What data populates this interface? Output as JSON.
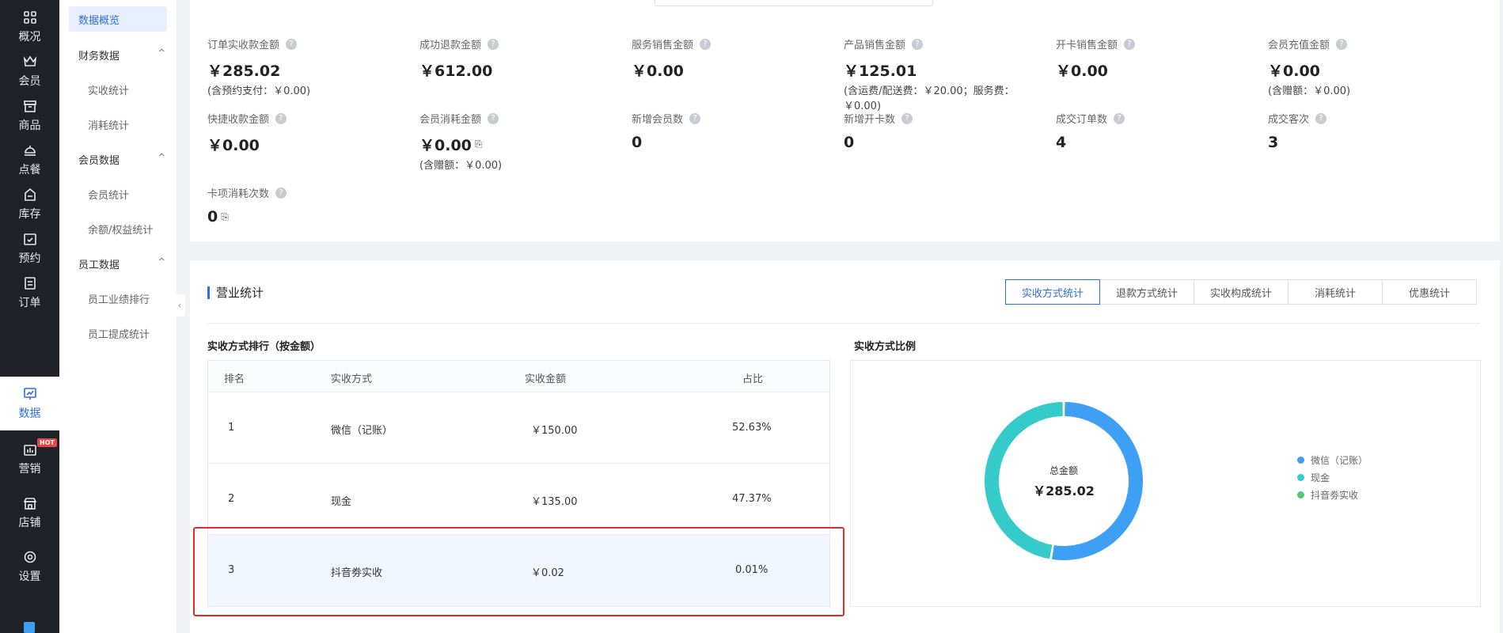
{
  "nav": {
    "items": [
      {
        "label": "概况",
        "icon": "grid-icon"
      },
      {
        "label": "会员",
        "icon": "crown-icon"
      },
      {
        "label": "商品",
        "icon": "store-box-icon"
      },
      {
        "label": "点餐",
        "icon": "dish-icon"
      },
      {
        "label": "库存",
        "icon": "inventory-icon"
      },
      {
        "label": "预约",
        "icon": "calendar-check-icon"
      },
      {
        "label": "订单",
        "icon": "order-list-icon"
      },
      {
        "label": "数据",
        "icon": "data-chart-icon"
      },
      {
        "label": "营销",
        "icon": "marketing-icon"
      },
      {
        "label": "店铺",
        "icon": "shop-icon"
      },
      {
        "label": "设置",
        "icon": "settings-icon"
      }
    ],
    "active": "数据",
    "hot_badge": "HOT"
  },
  "submenu": {
    "active": "数据概览",
    "groups": [
      {
        "label": "财务数据",
        "items": [
          "实收统计",
          "消耗统计"
        ]
      },
      {
        "label": "会员数据",
        "items": [
          "会员统计",
          "余额/权益统计"
        ]
      },
      {
        "label": "员工数据",
        "items": [
          "员工业绩排行",
          "员工提成统计"
        ]
      }
    ],
    "caret": "^",
    "collapse": "‹"
  },
  "stats": [
    {
      "label": "订单实收款金额",
      "value": "￥285.02",
      "note": "(含预约支付：￥0.00)"
    },
    {
      "label": "成功退款金额",
      "value": "￥612.00",
      "note": ""
    },
    {
      "label": "服务销售金额",
      "value": "￥0.00",
      "note": ""
    },
    {
      "label": "产品销售金额",
      "value": "￥125.01",
      "note": "(含运费/配送费：￥20.00；服务费：￥0.00)"
    },
    {
      "label": "开卡销售金额",
      "value": "￥0.00",
      "note": ""
    },
    {
      "label": "会员充值金额",
      "value": "￥0.00",
      "note": "(含赠额：￥0.00)"
    },
    {
      "label": "快捷收款金额",
      "value": "￥0.00",
      "note": ""
    },
    {
      "label": "会员消耗金额",
      "value": "￥0.00",
      "note": "(含赠额：￥0.00)",
      "doc": "⎘"
    },
    {
      "label": "新增会员数",
      "value": "0",
      "note": ""
    },
    {
      "label": "新增开卡数",
      "value": "0",
      "note": ""
    },
    {
      "label": "成交订单数",
      "value": "4",
      "note": ""
    },
    {
      "label": "成交客次",
      "value": "3",
      "note": ""
    },
    {
      "label": "卡项消耗次数",
      "value": "0",
      "note": "",
      "doc": "⎘"
    }
  ],
  "help_glyph": "?",
  "business": {
    "title": "营业统计",
    "tabs": [
      "实收方式统计",
      "退款方式统计",
      "实收构成统计",
      "消耗统计",
      "优惠统计"
    ],
    "active_tab": "实收方式统计",
    "ranking_title": "实收方式排行（按金额）",
    "ratio_title": "实收方式比例",
    "table": {
      "headers": [
        "排名",
        "实收方式",
        "实收金额",
        "占比"
      ],
      "rows": [
        {
          "rank": "1",
          "method": "微信（记账）",
          "amount": "￥150.00",
          "ratio": "52.63%"
        },
        {
          "rank": "2",
          "method": "现金",
          "amount": "￥135.00",
          "ratio": "47.37%"
        },
        {
          "rank": "3",
          "method": "抖音劵实收",
          "amount": "￥0.02",
          "ratio": "0.01%"
        }
      ]
    },
    "donut": {
      "center_label": "总金额",
      "center_value": "￥285.02"
    }
  },
  "chart_data": {
    "type": "pie",
    "categories": [
      "微信（记账）",
      "现金",
      "抖音劵实收"
    ],
    "values": [
      150.0,
      135.0,
      0.02
    ],
    "colors": [
      "#3ea0f5",
      "#36cbcb",
      "#4ecb73"
    ],
    "legend_position": "right"
  }
}
